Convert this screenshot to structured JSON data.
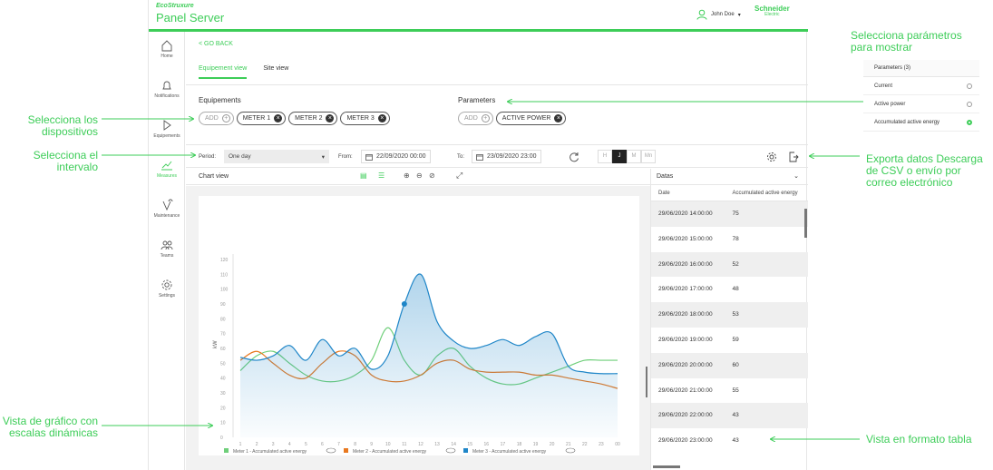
{
  "brand": {
    "top": "EcoStruxure",
    "main_light": "Panel",
    "main_bold": "Server"
  },
  "user": {
    "name": "John Doe"
  },
  "se_logo": {
    "line1": "Schneider",
    "line2": "Electric"
  },
  "nav": [
    {
      "label": "Home",
      "icon": "home-icon"
    },
    {
      "label": "Notifications",
      "icon": "bell-icon"
    },
    {
      "label": "Equipements",
      "icon": "play-icon"
    },
    {
      "label": "Measures",
      "icon": "chart-line-icon",
      "active": true
    },
    {
      "label": "Maintenance",
      "icon": "wrench-icon"
    },
    {
      "label": "Teams",
      "icon": "people-icon"
    },
    {
      "label": "Settings",
      "icon": "gear-icon"
    }
  ],
  "goback": "< GO BACK",
  "tabs": [
    {
      "label": "Equipement view",
      "active": true
    },
    {
      "label": "Site view"
    }
  ],
  "equipements": {
    "label": "Equipements",
    "add": "ADD",
    "chips": [
      "METER 1",
      "METER 2",
      "METER 3"
    ]
  },
  "parameters": {
    "label": "Parameters",
    "add": "ADD",
    "chips": [
      "ACTIVE POWER"
    ]
  },
  "toolbar": {
    "period_label": "Period:",
    "period_value": "One day",
    "from_label": "From:",
    "from_value": "22/09/2020 00:00",
    "to_label": "To:",
    "to_value": "23/09/2020 23:00",
    "granularity": [
      {
        "label": "H"
      },
      {
        "label": "J",
        "selected": true
      },
      {
        "label": "M"
      },
      {
        "label": "Mn"
      }
    ]
  },
  "chart_view_label": "Chart view",
  "chart_data": {
    "type": "line",
    "x": [
      1,
      2,
      3,
      4,
      5,
      6,
      7,
      8,
      9,
      10,
      11,
      12,
      13,
      14,
      15,
      16,
      17,
      18,
      19,
      20,
      21,
      22,
      23,
      24
    ],
    "x_tick_labels": [
      "1",
      "2",
      "3",
      "4",
      "5",
      "6",
      "7",
      "8",
      "9",
      "10",
      "11",
      "12",
      "13",
      "14",
      "15",
      "16",
      "17",
      "18",
      "19",
      "20",
      "21",
      "22",
      "23",
      "00"
    ],
    "ylabel": "kW",
    "ylim": [
      0,
      120
    ],
    "y_ticks": [
      0,
      10,
      20,
      30,
      40,
      50,
      60,
      70,
      80,
      90,
      100,
      110,
      120
    ],
    "series": [
      {
        "name": "Meter 1 - Accumulated active energy",
        "color": "#6fcf7a",
        "values": [
          45,
          55,
          58,
          50,
          42,
          38,
          38,
          42,
          52,
          74,
          52,
          42,
          55,
          60,
          48,
          40,
          36,
          36,
          40,
          44,
          48,
          52,
          52,
          52
        ]
      },
      {
        "name": "Meter 2 - Accumulated active energy",
        "color": "#e8781f",
        "values": [
          52,
          58,
          50,
          42,
          40,
          50,
          58,
          55,
          42,
          38,
          38,
          42,
          50,
          52,
          46,
          44,
          44,
          44,
          42,
          42,
          40,
          38,
          36,
          33
        ]
      },
      {
        "name": "Meter 3 - Accumulated active energy",
        "color": "#1f86c8",
        "values": [
          54,
          52,
          55,
          62,
          52,
          66,
          55,
          60,
          46,
          55,
          90,
          110,
          78,
          65,
          60,
          62,
          66,
          62,
          68,
          70,
          48,
          44,
          43,
          43
        ],
        "highlight_index": 10
      }
    ],
    "grid": false,
    "legend": "bottom"
  },
  "table": {
    "title": "Datas",
    "columns": [
      "Date",
      "Accumulated active energy"
    ],
    "rows": [
      [
        "29/06/2020 14:00:00",
        "75"
      ],
      [
        "29/06/2020 15:00:00",
        "78"
      ],
      [
        "29/06/2020 16:00:00",
        "52"
      ],
      [
        "29/06/2020 17:00:00",
        "48"
      ],
      [
        "29/06/2020 18:00:00",
        "53"
      ],
      [
        "29/06/2020 19:00:00",
        "59"
      ],
      [
        "29/06/2020 20:00:00",
        "60"
      ],
      [
        "29/06/2020 21:00:00",
        "55"
      ],
      [
        "29/06/2020 22:00:00",
        "43"
      ],
      [
        "29/06/2020 23:00:00",
        "43"
      ]
    ]
  },
  "params_panel": {
    "title": "Parameters (3)",
    "rows": [
      {
        "label": "Current",
        "selected": false
      },
      {
        "label": "Active power",
        "selected": false
      },
      {
        "label": "Accumulated active energy",
        "selected": true
      }
    ]
  },
  "annotations": {
    "params": "Selecciona parámetros para mostrar",
    "devices": "Selecciona los dispositivos",
    "interval": "Selecciona el intervalo",
    "export": "Exporta datos Descarga de CSV o envío por correo electrónico",
    "chart": "Vista de gráfico con escalas dinámicas",
    "table": "Vista en formato tabla"
  },
  "colors": {
    "accent": "#3dcd58"
  }
}
